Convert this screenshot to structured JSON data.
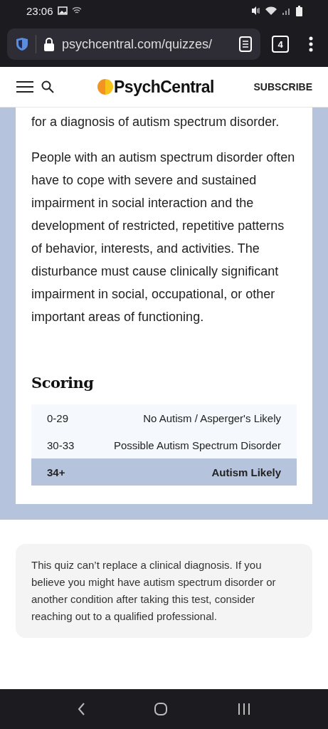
{
  "status_bar": {
    "time": "23:06"
  },
  "browser": {
    "url": "psychcentral.com/quizzes/",
    "tab_count": "4"
  },
  "site_header": {
    "logo": "PsychCentral",
    "subscribe": "SUBSCRIBE"
  },
  "article": {
    "paragraphs": [
      "for a diagnosis of autism spectrum disorder.",
      "People with an autism spectrum disorder often have to cope with severe and sustained impairment in social interaction and the development of restricted, repetitive patterns of behavior, interests, and activities. The disturbance must cause clinically significant impairment in social, occupational, or other important areas of functioning."
    ],
    "scoring": {
      "title": "Scoring",
      "rows": [
        {
          "range": "0-29",
          "result": "No Autism / Asperger's Likely",
          "highlighted": false
        },
        {
          "range": "30-33",
          "result": "Possible Autism Spectrum Disorder",
          "highlighted": false
        },
        {
          "range": "34+",
          "result": "Autism Likely",
          "highlighted": true
        }
      ]
    }
  },
  "disclaimer": "This quiz can’t replace a clinical diagnosis. If you believe you might have autism spectrum disorder or another condition after taking this test, consider reaching out to a qualified professional."
}
